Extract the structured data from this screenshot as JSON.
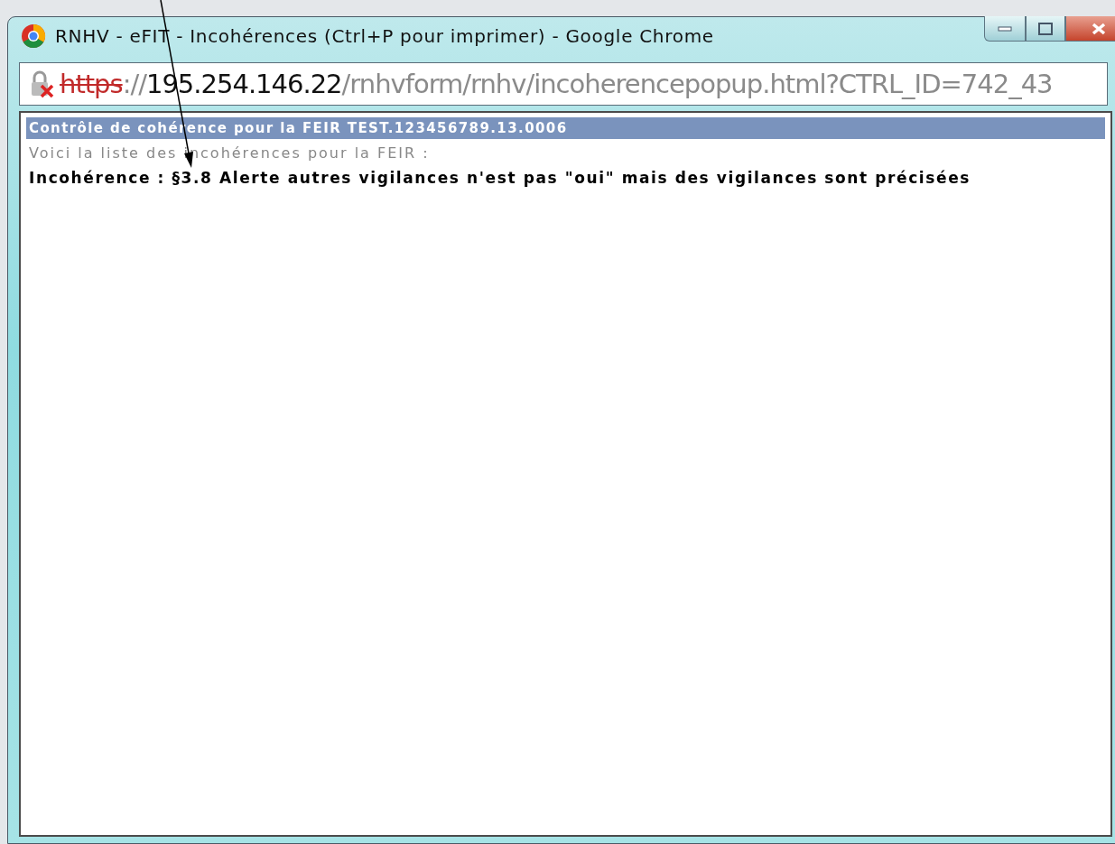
{
  "window": {
    "title": "RNHV - eFIT - Incohérences (Ctrl+P pour imprimer) - Google Chrome"
  },
  "address_bar": {
    "secure": false,
    "scheme": "https",
    "separator": "://",
    "host": "195.254.146.22",
    "path": "/rnhvform/rnhv/incoherencepopup.html?CTRL_ID=742_43"
  },
  "page": {
    "heading": "Contrôle de cohérence pour la FEIR TEST.123456789.13.0006",
    "intro": "Voici la liste des incohérences pour la FEIR :",
    "issues": [
      {
        "label": "Incohérence :",
        "text": "§3.8 Alerte autres vigilances n'est pas \"oui\" mais des vigilances sont précisées"
      }
    ]
  }
}
